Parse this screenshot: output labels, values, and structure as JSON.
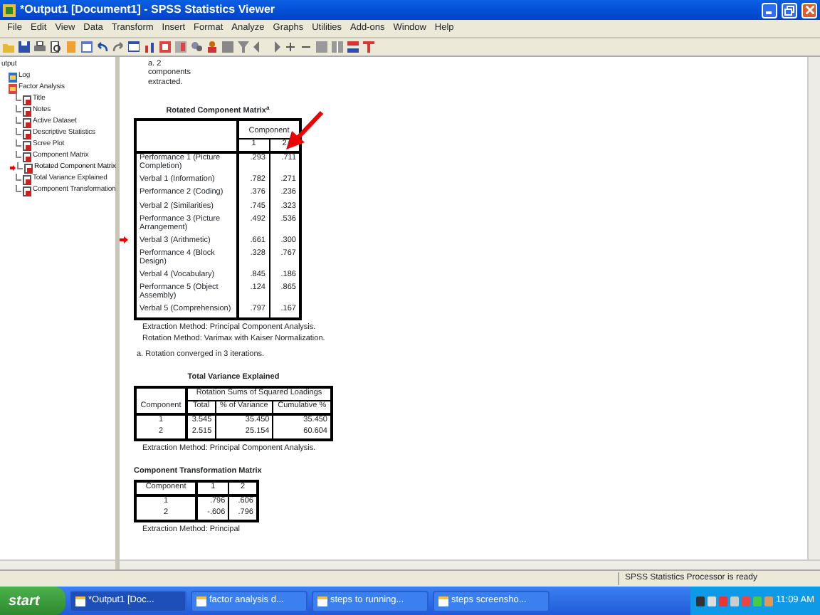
{
  "window": {
    "title": "*Output1 [Document1] - SPSS Statistics Viewer"
  },
  "menu": [
    "File",
    "Edit",
    "View",
    "Data",
    "Transform",
    "Insert",
    "Format",
    "Analyze",
    "Graphs",
    "Utilities",
    "Add-ons",
    "Window",
    "Help"
  ],
  "outline": {
    "label": "utput",
    "children": [
      {
        "label": "Log",
        "selected": false
      },
      {
        "label": "Factor Analysis",
        "selected": false,
        "children": [
          {
            "label": "Title",
            "selected": false
          },
          {
            "label": "Notes",
            "selected": false
          },
          {
            "label": "Active Dataset",
            "selected": false
          },
          {
            "label": "Descriptive Statistics",
            "selected": false
          },
          {
            "label": "Scree Plot",
            "selected": false
          },
          {
            "label": "Component Matrix",
            "selected": false
          },
          {
            "label": "Rotated Component Matrix",
            "selected": true
          },
          {
            "label": "Total Variance Explained",
            "selected": false
          },
          {
            "label": "Component Transformation",
            "selected": false
          }
        ]
      }
    ]
  },
  "output": {
    "top_footnote": "a. 2 components extracted.",
    "rotated_matrix": {
      "title": "Rotated Component Matrix$^{a}$",
      "group_header": "Component",
      "columns": [
        "1",
        "2"
      ],
      "rows": [
        {
          "label": "Performance 1 (Picture Completion)",
          "values": [
            ".293",
            ".711"
          ],
          "current": false
        },
        {
          "label": "Verbal 1 (Information)",
          "values": [
            ".782",
            ".271"
          ],
          "current": false
        },
        {
          "label": "Performance 2 (Coding)",
          "values": [
            ".376",
            ".236"
          ],
          "current": false
        },
        {
          "label": "Verbal 2 (Similarities)",
          "values": [
            ".745",
            ".323"
          ],
          "current": false
        },
        {
          "label": "Performance 3 (Picture Arrangement)",
          "values": [
            ".492",
            ".536"
          ],
          "current": false
        },
        {
          "label": "Verbal 3 (Arithmetic)",
          "values": [
            ".661",
            ".300"
          ],
          "current": true
        },
        {
          "label": "Performance 4 (Block Design)",
          "values": [
            ".328",
            ".767"
          ],
          "current": false
        },
        {
          "label": "Verbal 4 (Vocabulary)",
          "values": [
            ".845",
            ".186"
          ],
          "current": false
        },
        {
          "label": "Performance 5 (Object Assembly)",
          "values": [
            ".124",
            ".865"
          ],
          "current": false
        },
        {
          "label": "Verbal 5 (Comprehension)",
          "values": [
            ".797",
            ".167"
          ],
          "current": false
        }
      ],
      "notes": [
        "Extraction Method: Principal Component Analysis.",
        "Rotation Method: Varimax with Kaiser Normalization.",
        "a. Rotation converged in 3 iterations."
      ]
    },
    "total_variance": {
      "title": "Total Variance Explained",
      "group_header": "Rotation Sums of Squared Loadings",
      "row_header": "Component",
      "columns": [
        "Total",
        "% of Variance",
        "Cumulative %"
      ],
      "rows": [
        {
          "label": "1",
          "values": [
            "3.545",
            "35.450",
            "35.450"
          ]
        },
        {
          "label": "2",
          "values": [
            "2.515",
            "25.154",
            "60.604"
          ]
        }
      ],
      "notes": [
        "Extraction Method: Principal Component Analysis."
      ]
    },
    "transformation": {
      "title": "Component Transformation Matrix",
      "row_header": "Component",
      "columns": [
        "1",
        "2"
      ],
      "rows": [
        {
          "label": "1",
          "values": [
            ".796",
            ".606"
          ]
        },
        {
          "label": "2",
          "values": [
            "-.606",
            ".796"
          ]
        }
      ],
      "notes": [
        "Extraction Method: Principal"
      ]
    }
  },
  "status_bar": [
    "SPSS Statistics  Processor is ready"
  ],
  "taskbar": {
    "start": "start",
    "buttons": [
      {
        "label": "*Output1 [Doc...",
        "selected": true
      },
      {
        "label": "factor analysis d...",
        "selected": false
      },
      {
        "label": "steps to running...",
        "selected": false
      },
      {
        "label": "steps screensho...",
        "selected": false
      }
    ],
    "clock": "11:09 AM"
  }
}
